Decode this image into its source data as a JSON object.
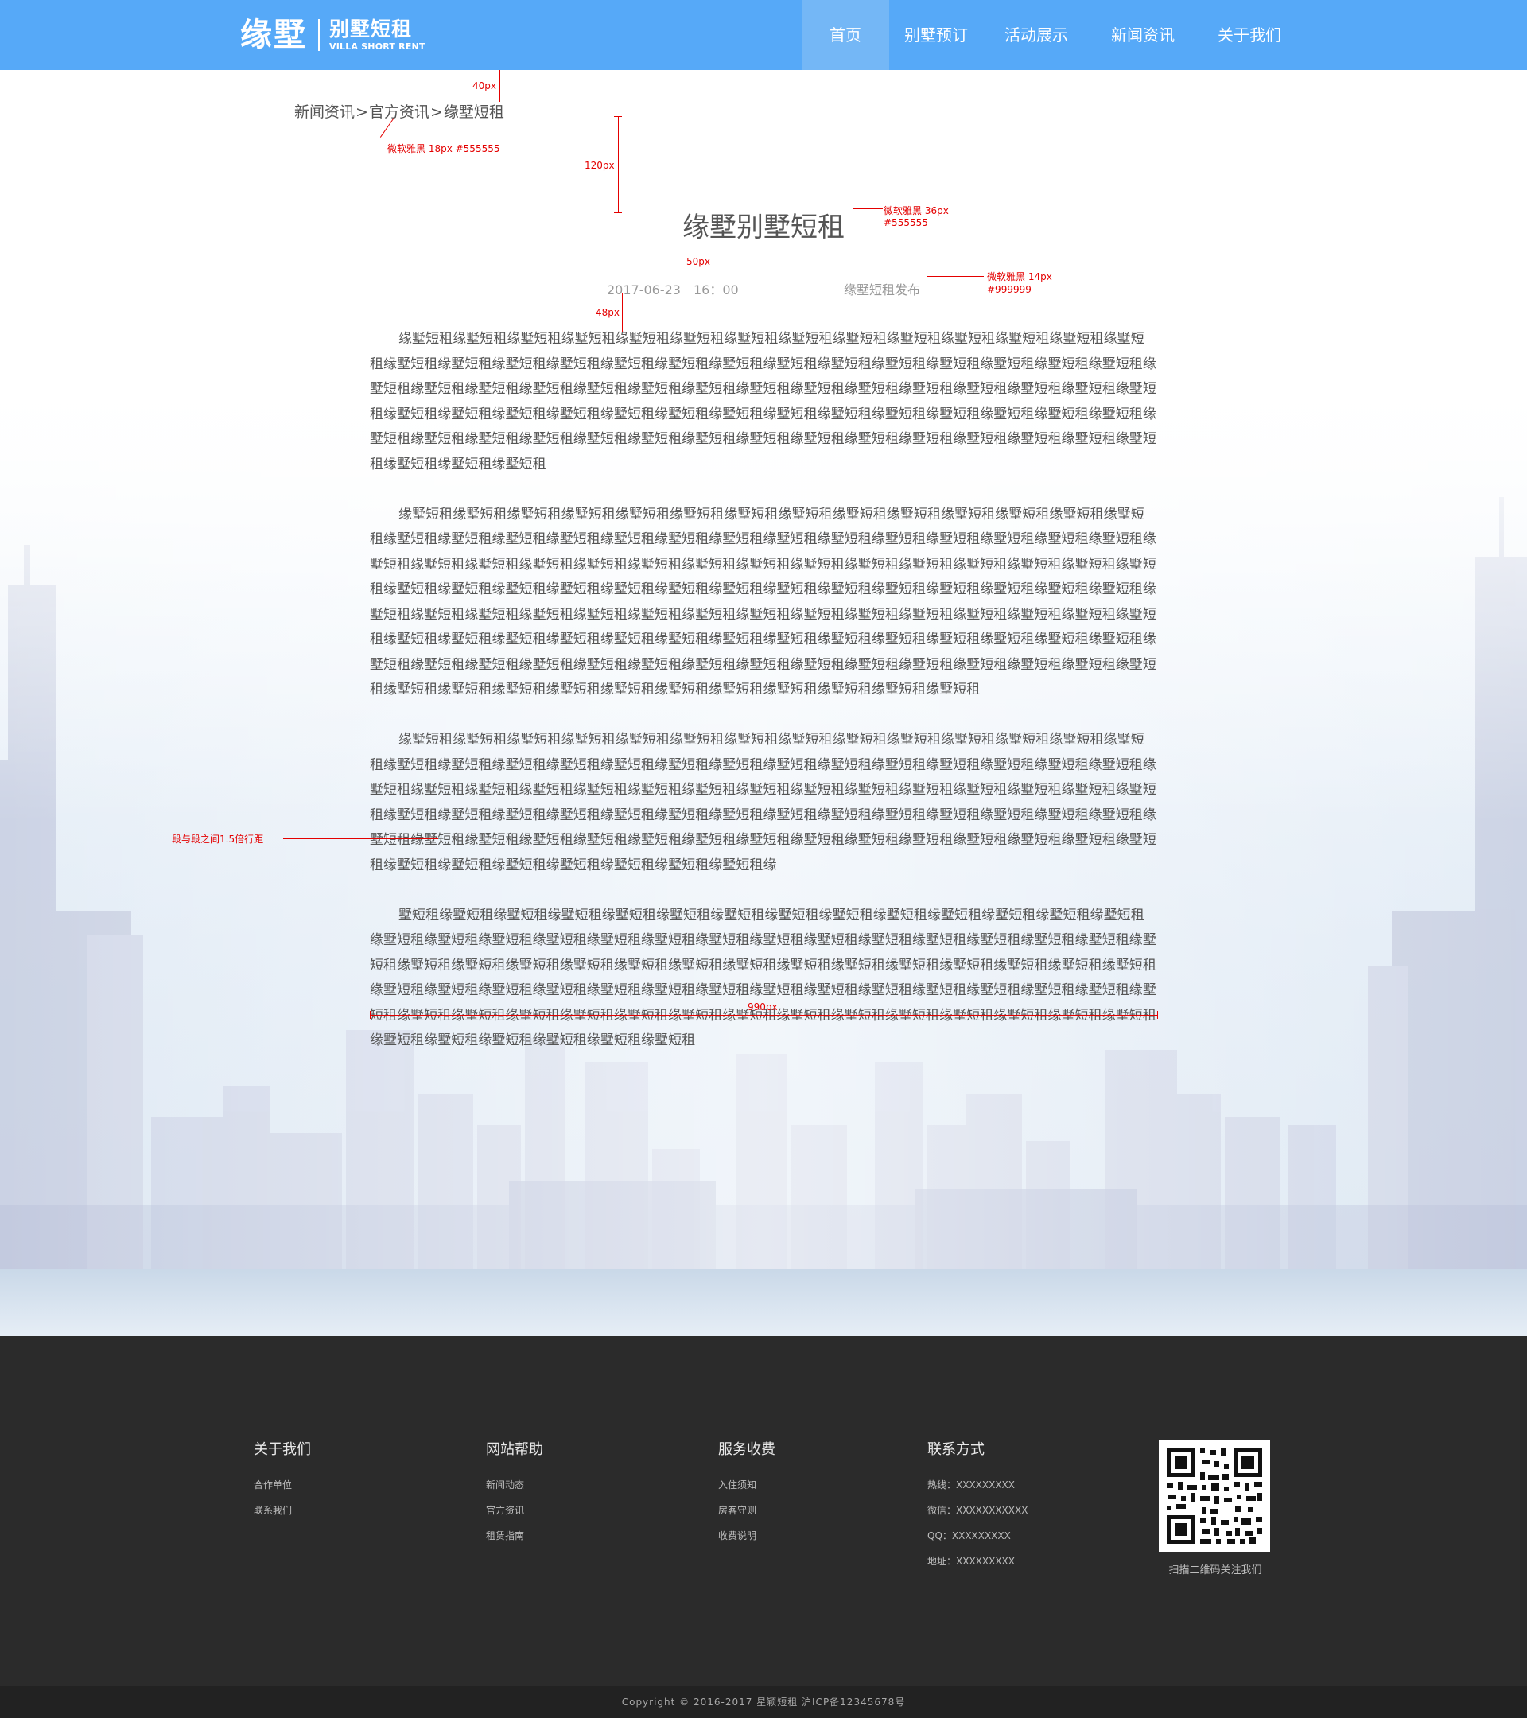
{
  "header": {
    "logo_main": "缘墅",
    "logo_sub_cn": "别墅短租",
    "logo_sub_en": "VILLA SHORT RENT",
    "nav": [
      {
        "label": "首页",
        "active": true
      },
      {
        "label": "别墅预订",
        "active": false
      },
      {
        "label": "活动展示",
        "active": false
      },
      {
        "label": "新闻资讯",
        "active": false
      },
      {
        "label": "关于我们",
        "active": false
      }
    ]
  },
  "breadcrumb": {
    "items": [
      "新闻资讯",
      "官方资讯",
      "缘墅短租"
    ],
    "separator": ">"
  },
  "article": {
    "title": "缘墅别墅短租",
    "date": "2017-06-23",
    "time": "16：00",
    "author": "缘墅短租发布",
    "paragraphs": [
      "缘墅短租缘墅短租缘墅短租缘墅短租缘墅短租缘墅短租缘墅短租缘墅短租缘墅短租缘墅短租缘墅短租缘墅短租缘墅短租缘墅短租缘墅短租缘墅短租缘墅短租缘墅短租缘墅短租缘墅短租缘墅短租缘墅短租缘墅短租缘墅短租缘墅短租缘墅短租缘墅短租缘墅短租缘墅短租缘墅短租缘墅短租缘墅短租缘墅短租缘墅短租缘墅短租缘墅短租缘墅短租缘墅短租缘墅短租缘墅短租缘墅短租缘墅短租缘墅短租缘墅短租缘墅短租缘墅短租缘墅短租缘墅短租缘墅短租缘墅短租缘墅短租缘墅短租缘墅短租缘墅短租缘墅短租缘墅短租缘墅短租缘墅短租缘墅短租缘墅短租缘墅短租缘墅短租缘墅短租缘墅短租缘墅短租缘墅短租缘墅短租缘墅短租缘墅短租缘墅短租缘墅短租缘墅短租缘墅短租缘墅短租缘墅短租",
      "缘墅短租缘墅短租缘墅短租缘墅短租缘墅短租缘墅短租缘墅短租缘墅短租缘墅短租缘墅短租缘墅短租缘墅短租缘墅短租缘墅短租缘墅短租缘墅短租缘墅短租缘墅短租缘墅短租缘墅短租缘墅短租缘墅短租缘墅短租缘墅短租缘墅短租缘墅短租缘墅短租缘墅短租缘墅短租缘墅短租缘墅短租缘墅短租缘墅短租缘墅短租缘墅短租缘墅短租缘墅短租缘墅短租缘墅短租缘墅短租缘墅短租缘墅短租缘墅短租缘墅短租缘墅短租缘墅短租缘墅短租缘墅短租缘墅短租缘墅短租缘墅短租缘墅短租缘墅短租缘墅短租缘墅短租缘墅短租缘墅短租缘墅短租缘墅短租缘墅短租缘墅短租缘墅短租缘墅短租缘墅短租缘墅短租缘墅短租缘墅短租缘墅短租缘墅短租缘墅短租缘墅短租缘墅短租缘墅短租缘墅短租缘墅短租缘墅短租缘墅短租缘墅短租缘墅短租缘墅短租缘墅短租缘墅短租缘墅短租缘墅短租缘墅短租缘墅短租缘墅短租缘墅短租缘墅短租缘墅短租缘墅短租缘墅短租缘墅短租缘墅短租缘墅短租缘墅短租缘墅短租缘墅短租缘墅短租缘墅短租缘墅短租缘墅短租缘墅短租缘墅短租缘墅短租缘墅短租缘墅短租缘墅短租缘墅短租缘墅短租缘墅短租缘墅短租",
      "缘墅短租缘墅短租缘墅短租缘墅短租缘墅短租缘墅短租缘墅短租缘墅短租缘墅短租缘墅短租缘墅短租缘墅短租缘墅短租缘墅短租缘墅短租缘墅短租缘墅短租缘墅短租缘墅短租缘墅短租缘墅短租缘墅短租缘墅短租缘墅短租缘墅短租缘墅短租缘墅短租缘墅短租缘墅短租缘墅短租缘墅短租缘墅短租缘墅短租缘墅短租缘墅短租缘墅短租缘墅短租缘墅短租缘墅短租缘墅短租缘墅短租缘墅短租缘墅短租缘墅短租缘墅短租缘墅短租缘墅短租缘墅短租缘墅短租缘墅短租缘墅短租缘墅短租缘墅短租缘墅短租缘墅短租缘墅短租缘墅短租缘墅短租缘墅短租缘墅短租缘墅短租缘墅短租缘墅短租缘墅短租缘墅短租缘墅短租缘墅短租缘墅短租缘墅短租缘墅短租缘墅短租缘墅短租缘墅短租缘墅短租缘墅短租缘墅短租缘墅短租缘墅短租缘墅短租缘",
      "墅短租缘墅短租缘墅短租缘墅短租缘墅短租缘墅短租缘墅短租缘墅短租缘墅短租缘墅短租缘墅短租缘墅短租缘墅短租缘墅短租缘墅短租缘墅短租缘墅短租缘墅短租缘墅短租缘墅短租缘墅短租缘墅短租缘墅短租缘墅短租缘墅短租缘墅短租缘墅短租缘墅短租缘墅短租缘墅短租缘墅短租缘墅短租缘墅短租缘墅短租缘墅短租缘墅短租缘墅短租缘墅短租缘墅短租缘墅短租缘墅短租缘墅短租缘墅短租缘墅短租缘墅短租缘墅短租缘墅短租缘墅短租缘墅短租缘墅短租缘墅短租缘墅短租缘墅短租缘墅短租缘墅短租缘墅短租缘墅短租缘墅短租缘墅短租缘墅短租缘墅短租缘墅短租缘墅短租缘墅短租缘墅短租缘墅短租缘墅短租缘墅短租缘墅短租缘墅短租缘墅短租缘墅短租缘墅短租缘墅短租缘墅短租缘墅短租缘墅短租缘墅短租"
    ]
  },
  "annotations": {
    "spacing_40": "40px",
    "crumb_font": "微软雅黑  18px  #555555",
    "spacing_120": "120px",
    "title_font_line1": "微软雅黑  36px",
    "title_font_line2": "#555555",
    "spacing_50": "50px",
    "meta_font_line1": "微软雅黑  14px",
    "meta_font_line2": "#999999",
    "spacing_48": "48px",
    "para_spacing": "段与段之间1.5倍行距",
    "width_990": "990px"
  },
  "footer": {
    "columns": [
      {
        "heading": "关于我们",
        "links": [
          "合作单位",
          "联系我们"
        ]
      },
      {
        "heading": "网站帮助",
        "links": [
          "新闻动态",
          "官方资讯",
          "租赁指南"
        ]
      },
      {
        "heading": "服务收费",
        "links": [
          "入住须知",
          "房客守则",
          "收费说明"
        ]
      }
    ],
    "contact": {
      "heading": "联系方式",
      "lines": [
        "热线：XXXXXXXXX",
        "微信：XXXXXXXXXXX",
        "QQ：XXXXXXXXX",
        "地址：XXXXXXXXX"
      ]
    },
    "qr_caption": "扫描二维码关注我们",
    "copyright": "Copyright © 2016-2017 星颖短租 沪ICP备12345678号"
  },
  "colors": {
    "header_bg": "#56a9f8",
    "nav_active_bg": "#74b7f6",
    "text": "#555555",
    "meta": "#999999",
    "annotation": "#e40000",
    "footer_bg": "#2b2b2b",
    "copyright_bg": "#222222"
  }
}
